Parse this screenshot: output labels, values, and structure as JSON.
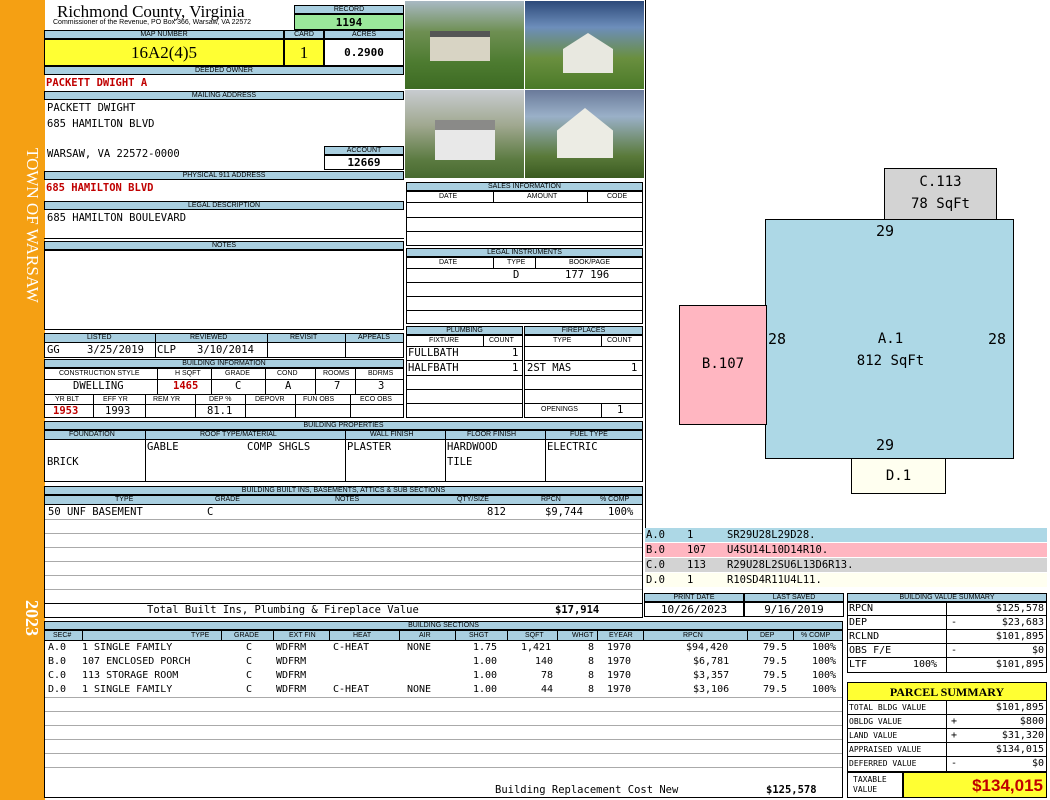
{
  "sidebar": {
    "town": "TOWN OF WARSAW",
    "year": "2023"
  },
  "county": {
    "name": "Richmond County, Virginia",
    "sub": "Commissioner of the Revenue, PO Box 366, Warsaw, VA 22572"
  },
  "record": {
    "label": "RECORD",
    "value": "1194"
  },
  "map": {
    "label": "MAP NUMBER",
    "value": "16A2(4)5",
    "card_label": "CARD",
    "card": "1",
    "acres_label": "ACRES",
    "acres": "0.2900"
  },
  "owner": {
    "label": "DEEDED OWNER",
    "value": "PACKETT DWIGHT A"
  },
  "mailing": {
    "label": "MAILING ADDRESS",
    "line1": "PACKETT DWIGHT",
    "line2": "685 HAMILTON BLVD",
    "line3": "WARSAW, VA 22572-0000"
  },
  "account": {
    "label": "ACCOUNT",
    "value": "12669"
  },
  "physical": {
    "label": "PHYSICAL 911 ADDRESS",
    "value": "685 HAMILTON BLVD"
  },
  "legal": {
    "label": "LEGAL DESCRIPTION",
    "value": "685 HAMILTON BOULEVARD"
  },
  "notes": {
    "label": "NOTES"
  },
  "sales": {
    "label": "SALES INFORMATION",
    "cols": [
      "DATE",
      "AMOUNT",
      "CODE"
    ]
  },
  "instruments": {
    "label": "LEGAL INSTRUMENTS",
    "cols": [
      "DATE",
      "TYPE",
      "BOOK/PAGE"
    ],
    "type": "D",
    "bookpage": "177 196"
  },
  "listed": {
    "h": [
      "LISTED",
      "REVIEWED",
      "REVISIT",
      "APPEALS"
    ],
    "by1": "GG",
    "date1": "3/25/2019",
    "by2": "CLP",
    "date2": "3/10/2014"
  },
  "building_info": {
    "label": "BUILDING INFORMATION",
    "h": [
      "CONSTRUCTION STYLE",
      "H SQFT",
      "GRADE",
      "COND",
      "ROOMS",
      "BDRMS"
    ],
    "v": [
      "DWELLING",
      "1465",
      "C",
      "A",
      "7",
      "3"
    ],
    "h2": [
      "YR BLT",
      "EFF YR",
      "REM YR",
      "DEP %",
      "DEPOVR",
      "FUN OBS",
      "ECO OBS"
    ],
    "v2": [
      "1953",
      "1993",
      "",
      "81.1",
      "",
      "",
      ""
    ]
  },
  "plumbing": {
    "label": "PLUMBING",
    "h": [
      "FIXTURE",
      "COUNT"
    ],
    "rows": [
      [
        "FULLBATH",
        "1"
      ],
      [
        "HALFBATH",
        "1"
      ]
    ]
  },
  "fireplaces": {
    "label": "FIREPLACES",
    "h": [
      "TYPE",
      "COUNT"
    ],
    "rows": [
      [
        "2ST MAS",
        "1"
      ]
    ],
    "openings_label": "OPENINGS",
    "openings": "1"
  },
  "props": {
    "label": "BUILDING PROPERTIES",
    "h": [
      "FOUNDATION",
      "ROOF TYPE/MATERIAL",
      "WALL FINISH",
      "FLOOR FINISH",
      "FUEL TYPE"
    ],
    "foundation": "BRICK",
    "roof1": "GABLE",
    "roof2": "COMP SHGLS",
    "wall": "PLASTER",
    "floor1": "HARDWOOD",
    "floor2": "TILE",
    "fuel": "ELECTRIC"
  },
  "builtins": {
    "label": "BUILDING BUILT INS, BASEMENTS, ATTICS & SUB SECTIONS",
    "h": [
      "TYPE",
      "GRADE",
      "NOTES",
      "QTY/SIZE",
      "RPCN",
      "% COMP"
    ],
    "row": {
      "type": "50 UNF BASEMENT",
      "grade": "C",
      "qty": "812",
      "rpcn": "$9,744",
      "comp": "100%"
    },
    "total_label": "Total Built Ins, Plumbing & Fireplace Value",
    "total": "$17,914"
  },
  "sketch_codes": [
    {
      "code": "A.0",
      "n": "1",
      "path": "SR29U28L29D28.",
      "bg": "#add8e6"
    },
    {
      "code": "B.0",
      "n": "107",
      "path": "U4SU14L10D14R10.",
      "bg": "#ffb6c1"
    },
    {
      "code": "C.0",
      "n": "113",
      "path": "R29U28L2SU6L13D6R13.",
      "bg": "#d3d3d3"
    },
    {
      "code": "D.0",
      "n": "1",
      "path": "R10SD4R11U4L11.",
      "bg": "#fffff0"
    }
  ],
  "sketch": {
    "a_name": "A.1",
    "a_area": "812 SqFt",
    "b_name": "B.107",
    "c_name": "C.113",
    "c_area": "78 SqFt",
    "d_name": "D.1",
    "top": "29",
    "bottom": "29",
    "left": "28",
    "right": "28"
  },
  "print": {
    "h1": "PRINT DATE",
    "h2": "LAST SAVED",
    "v1": "10/26/2023",
    "v2": "9/16/2019"
  },
  "summary": {
    "label": "BUILDING VALUE SUMMARY",
    "rows": [
      {
        "k": "RPCN",
        "s": "",
        "v": "$125,578"
      },
      {
        "k": "DEP",
        "s": "-",
        "v": "$23,683"
      },
      {
        "k": "RCLND",
        "s": "",
        "v": "$101,895"
      },
      {
        "k": "OBS F/E",
        "s": "-",
        "v": "$0"
      },
      {
        "k": "LTF",
        "p": "100%",
        "s": "",
        "v": "$101,895"
      }
    ]
  },
  "parcel": {
    "label": "PARCEL SUMMARY",
    "rows": [
      {
        "k": "TOTAL BLDG VALUE",
        "s": "",
        "v": "$101,895"
      },
      {
        "k": "OBLDG VALUE",
        "s": "+",
        "v": "$800"
      },
      {
        "k": "LAND VALUE",
        "s": "+",
        "v": "$31,320"
      },
      {
        "k": "APPRAISED VALUE",
        "s": "",
        "v": "$134,015"
      },
      {
        "k": "DEFERRED VALUE",
        "s": "-",
        "v": "$0"
      }
    ],
    "taxable_label1": "TAXABLE",
    "taxable_label2": "VALUE",
    "taxable": "$134,015"
  },
  "sections": {
    "label": "BUILDING SECTIONS",
    "h": [
      "SEC#",
      "TYPE",
      "GRADE",
      "EXT FIN",
      "HEAT",
      "AIR",
      "SHGT",
      "SQFT",
      "WHGT",
      "EYEAR",
      "RPCN",
      "DEP",
      "% COMP"
    ],
    "rows": [
      [
        "A.0",
        "1 SINGLE FAMILY",
        "C",
        "WDFRM",
        "C-HEAT",
        "NONE",
        "1.75",
        "1,421",
        "8",
        "1970",
        "$94,420",
        "79.5",
        "100%"
      ],
      [
        "B.0",
        "107 ENCLOSED PORCH",
        "C",
        "WDFRM",
        "",
        "",
        "1.00",
        "140",
        "8",
        "1970",
        "$6,781",
        "79.5",
        "100%"
      ],
      [
        "C.0",
        "113 STORAGE ROOM",
        "C",
        "WDFRM",
        "",
        "",
        "1.00",
        "78",
        "8",
        "1970",
        "$3,357",
        "79.5",
        "100%"
      ],
      [
        "D.0",
        "1 SINGLE FAMILY",
        "C",
        "WDFRM",
        "C-HEAT",
        "NONE",
        "1.00",
        "44",
        "8",
        "1970",
        "$3,106",
        "79.5",
        "100%"
      ]
    ],
    "total_label": "Building Replacement Cost New",
    "total": "$125,578"
  }
}
